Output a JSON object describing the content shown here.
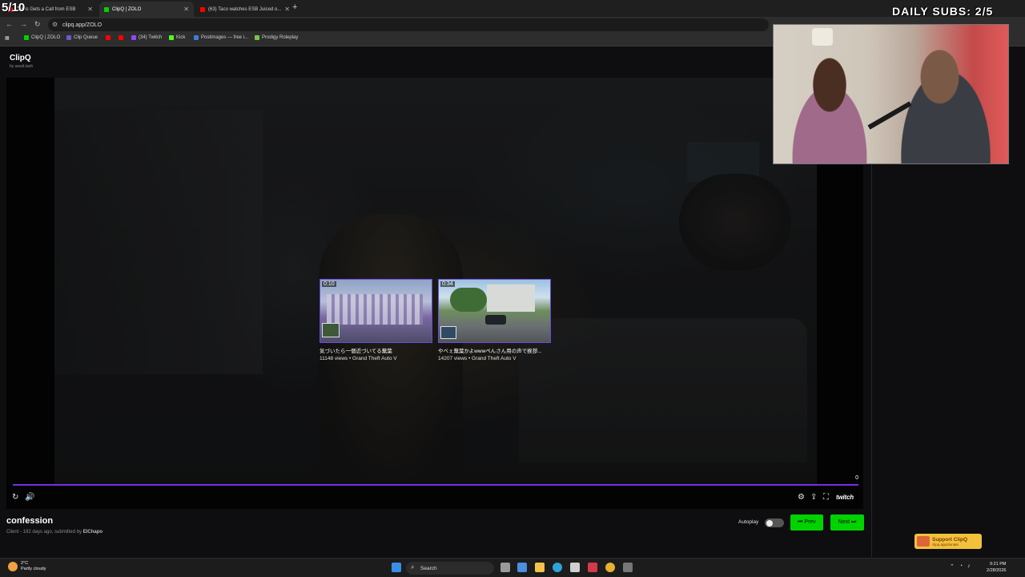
{
  "browser": {
    "tabs": [
      {
        "label": "Curtis Gets a Call from ESB",
        "active": false,
        "favicon_color": "#ff0000"
      },
      {
        "label": "ClipQ | ZOLO",
        "active": true,
        "favicon_color": "#00d300"
      },
      {
        "label": "(63) Taco watches ESB Juiced o...",
        "active": false,
        "favicon_color": "#ff0000"
      }
    ],
    "url": "clipq.app/ZOLO",
    "bookmarks": [
      {
        "label": "ClipQ | ZOLO",
        "color": "#00d300"
      },
      {
        "label": "Clip Queue",
        "color": "#6a5acd"
      },
      {
        "label": "",
        "color": "#ff0000"
      },
      {
        "label": "",
        "color": "#ff0000"
      },
      {
        "label": "(34) Twitch",
        "color": "#9146ff"
      },
      {
        "label": "Kick",
        "color": "#53fc18"
      },
      {
        "label": "Postimages — free i...",
        "color": "#3c7dd9"
      },
      {
        "label": "Prodigy Roleplay",
        "color": "#7cc24a"
      }
    ]
  },
  "app": {
    "name": "ClipQ",
    "byline": "by await.tash"
  },
  "player": {
    "suggestions": [
      {
        "duration": "0:10",
        "title": "気づいたら一個近づいてる蕪葉",
        "meta": "11148 views • Grand Theft Auto V"
      },
      {
        "duration": "0:34",
        "title": "やべぇ蕪葉かよwwwぺんさん用の声で挨拶...",
        "meta": "14207 views • Grand Theft Auto V"
      }
    ],
    "counter": "0",
    "twitch_label": "twitch",
    "progress": 1.0,
    "accent": "#772ce8"
  },
  "clip": {
    "title": "confession",
    "meta_prefix": "Client - 192 days ago, submitted by",
    "submitter": "ElChapo"
  },
  "controls": {
    "autoplay_label": "Autoplay",
    "autoplay_on": false,
    "prev_label": "⏮ Prev",
    "next_label": "Next ⏭",
    "button_color": "#00d300"
  },
  "support": {
    "title": "Support ClipQ",
    "subtitle": "clipq.app/donate"
  },
  "stream_overlay": {
    "count": "5/10",
    "daily_subs": "DAILY SUBS: 2/5"
  },
  "taskbar": {
    "weather_temp": "2°C",
    "weather_desc": "Partly cloudy",
    "search_label": "Search",
    "time": "9:21 PM",
    "date": "2/28/2026"
  }
}
